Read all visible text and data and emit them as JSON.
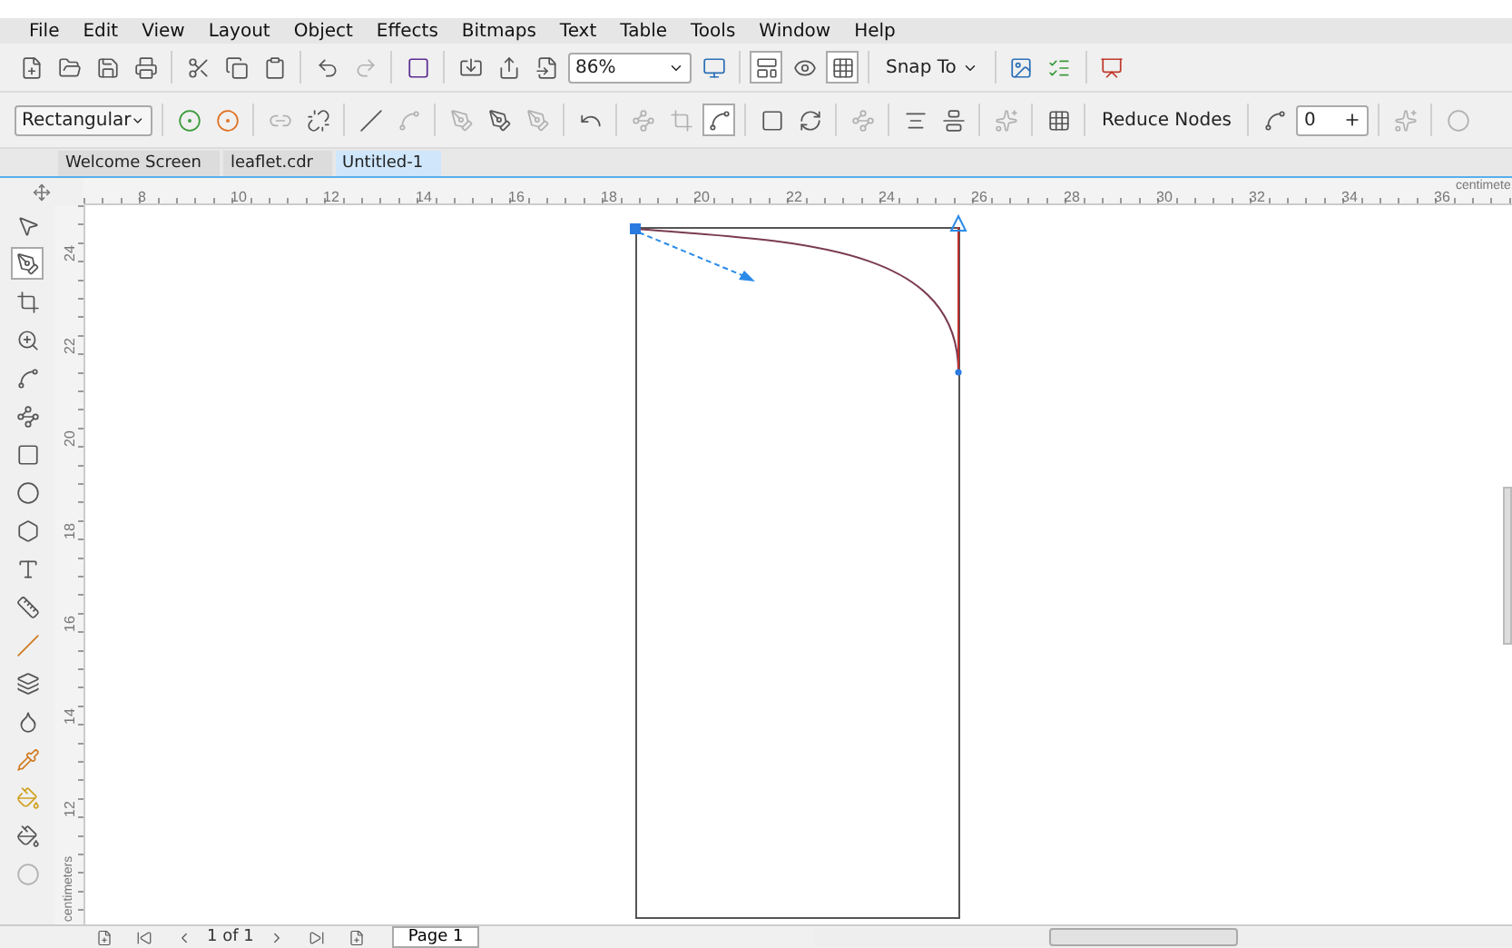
{
  "menu": [
    "File",
    "Edit",
    "View",
    "Layout",
    "Object",
    "Effects",
    "Bitmaps",
    "Text",
    "Table",
    "Tools",
    "Window",
    "Help"
  ],
  "toolbar": {
    "zoom": "86%",
    "snap": "Snap To"
  },
  "property_bar": {
    "mode": "Rectangular",
    "reduce_nodes": "Reduce Nodes",
    "smoothness": "0"
  },
  "tabs": [
    {
      "label": "Welcome Screen",
      "selected": false
    },
    {
      "label": "leaflet.cdr",
      "selected": false
    },
    {
      "label": "Untitled-1",
      "selected": true
    }
  ],
  "ruler": {
    "horizontal": [
      "8",
      "10",
      "12",
      "14",
      "16",
      "18",
      "20",
      "22",
      "24",
      "26",
      "28",
      "30",
      "32",
      "34",
      "36"
    ],
    "unit": "centimete",
    "vertical": [
      "24",
      "22",
      "20",
      "18",
      "16",
      "14",
      "12"
    ],
    "vertical_unit": "centimeters"
  },
  "page_nav": {
    "counter": "1 of 1",
    "page_tab": "Page 1"
  }
}
